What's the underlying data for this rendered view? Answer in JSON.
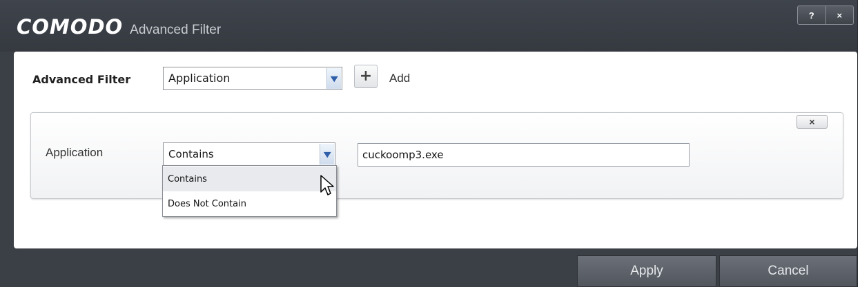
{
  "window": {
    "brand": "COMODO",
    "title": "Advanced Filter",
    "help_label": "?",
    "close_label": "×"
  },
  "filter": {
    "label": "Advanced Filter",
    "selected": "Application",
    "add_label": "Add",
    "add_icon": "plus-icon"
  },
  "rule": {
    "close_label": "×",
    "label": "Application",
    "operator": "Contains",
    "value": "cuckoomp3.exe"
  },
  "dropdown": {
    "options": [
      "Contains",
      "Does Not Contain"
    ],
    "hovered": "Contains"
  },
  "footer": {
    "apply_label": "Apply",
    "cancel_label": "Cancel"
  },
  "colors": {
    "titlebar": "#3b3f46",
    "panel": "#ffffff",
    "footer_button": "#5d6269"
  }
}
